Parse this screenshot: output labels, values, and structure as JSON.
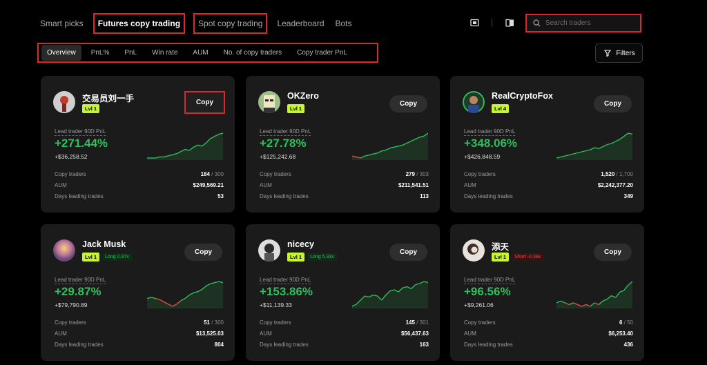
{
  "nav": {
    "items": [
      "Smart picks",
      "Futures copy trading",
      "Spot copy trading",
      "Leaderboard",
      "Bots"
    ]
  },
  "search": {
    "placeholder": "Search traders"
  },
  "filters": {
    "tabs": [
      "Overview",
      "PnL%",
      "PnL",
      "Win rate",
      "AUM",
      "No. of copy traders",
      "Copy trader PnL"
    ],
    "button_label": "Filters"
  },
  "card_labels": {
    "copy": "Copy",
    "lead_pnl": "Lead trader 90D PnL",
    "copy_traders": "Copy traders",
    "aum": "AUM",
    "days": "Days leading trades"
  },
  "traders": [
    {
      "name": "交易员刘一手",
      "level": "Lvl 1",
      "position": "",
      "pnl_pct": "+271.44%",
      "pnl_abs": "+$36,258.52",
      "copy_traders": "184",
      "copy_max": "300",
      "aum": "$249,569.21",
      "days": "53",
      "spark": [
        2,
        2,
        2,
        3,
        3,
        4,
        5,
        6,
        8,
        10,
        9,
        12,
        14,
        13,
        16,
        20,
        22,
        24,
        25
      ]
    },
    {
      "name": "OKZero",
      "level": "Lvl 1",
      "position": "",
      "pnl_pct": "+27.78%",
      "pnl_abs": "+$125,242.68",
      "copy_traders": "279",
      "copy_max": "303",
      "aum": "$211,541.51",
      "days": "113",
      "spark": [
        3,
        2,
        1,
        3,
        4,
        5,
        6,
        8,
        9,
        11,
        12,
        13,
        14,
        16,
        18,
        20,
        22,
        23,
        26
      ]
    },
    {
      "name": "RealCryptoFox",
      "level": "Lvl 4",
      "position": "",
      "pnl_pct": "+348.06%",
      "pnl_abs": "+$426,848.59",
      "copy_traders": "1,520",
      "copy_max": "1,700",
      "aum": "$2,242,377.20",
      "days": "349",
      "spark": [
        1,
        2,
        3,
        4,
        5,
        6,
        7,
        8,
        9,
        11,
        10,
        12,
        14,
        15,
        17,
        19,
        22,
        25,
        24
      ]
    },
    {
      "name": "Jack Musk",
      "level": "Lvl 1",
      "position": "Long 2.87x",
      "pnl_pct": "+29.87%",
      "pnl_abs": "+$79,790.89",
      "copy_traders": "51",
      "copy_max": "300",
      "aum": "$13,525.03",
      "days": "804",
      "spark": [
        9,
        10,
        9,
        8,
        6,
        4,
        2,
        4,
        7,
        9,
        12,
        14,
        15,
        17,
        20,
        22,
        23,
        24,
        23
      ]
    },
    {
      "name": "nicecy",
      "level": "Lvl 1",
      "position": "Long 5.33x",
      "pnl_pct": "+153.86%",
      "pnl_abs": "+$11,139.33",
      "copy_traders": "145",
      "copy_max": "301",
      "aum": "$56,437.63",
      "days": "163",
      "spark": [
        2,
        4,
        8,
        12,
        11,
        13,
        12,
        8,
        13,
        17,
        18,
        16,
        20,
        21,
        19,
        23,
        24,
        26,
        25
      ]
    },
    {
      "name": "添天",
      "level": "Lvl 1",
      "position": "Short -0.38x",
      "pnl_pct": "+96.56%",
      "pnl_abs": "+$9,261.06",
      "copy_traders": "6",
      "copy_max": "50",
      "aum": "$6,253.40",
      "days": "436",
      "spark": [
        10,
        11,
        10,
        9,
        10,
        9,
        8,
        9,
        8,
        10,
        9,
        11,
        12,
        14,
        13,
        16,
        17,
        20,
        22
      ]
    }
  ],
  "colors": {
    "accent_green": "#2fbf5b",
    "loss_red": "#e64c4c",
    "level_badge": "#c6f432",
    "highlight_red": "#e0262b"
  }
}
